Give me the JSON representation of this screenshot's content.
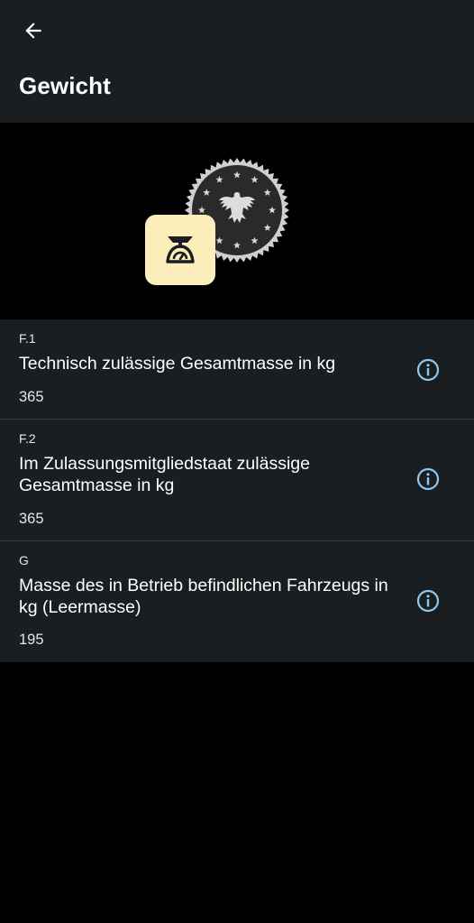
{
  "header": {
    "back_icon": "arrow-left-icon",
    "title": "Gewicht"
  },
  "hero": {
    "seal_icon": "federal-eagle-seal-icon",
    "tile_icon": "weighing-scale-icon",
    "tile_color": "#fbeeba"
  },
  "colors": {
    "surface": "#1b1e21",
    "background": "#000000",
    "accent": "#8ec8f0",
    "divider": "#3b3f43"
  },
  "items": [
    {
      "code": "F.1",
      "label": "Technisch zulässige Gesamtmasse in kg",
      "value": "365",
      "info_icon": "info-circle-icon"
    },
    {
      "code": "F.2",
      "label": "Im Zulassungsmitgliedstaat zulässige Gesamtmasse in kg",
      "value": "365",
      "info_icon": "info-circle-icon"
    },
    {
      "code": "G",
      "label": "Masse des in Betrieb befindlichen Fahrzeugs in kg (Leermasse)",
      "value": "195",
      "info_icon": "info-circle-icon"
    }
  ]
}
